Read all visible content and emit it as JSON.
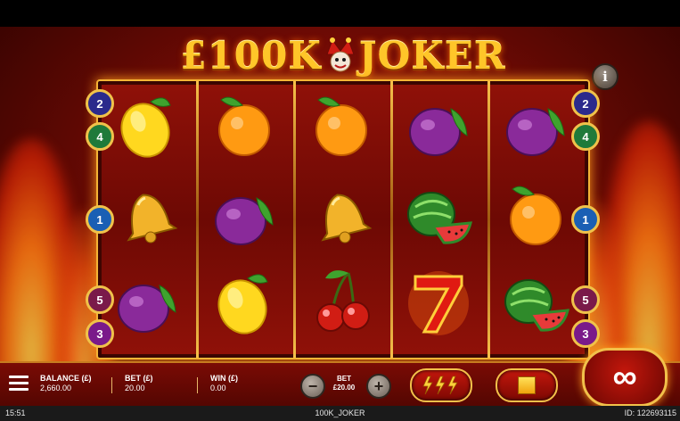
{
  "game": {
    "title": "£100K JOKER",
    "title_left": "£100K",
    "title_right": "JOKER"
  },
  "info_button": {
    "label": "i"
  },
  "reels": [
    [
      "lemon",
      "bell",
      "plum"
    ],
    [
      "orange",
      "plum",
      "lemon"
    ],
    [
      "orange",
      "bell",
      "cherries"
    ],
    [
      "plum",
      "watermelon",
      "seven"
    ],
    [
      "plum",
      "orange",
      "watermelon"
    ]
  ],
  "paylines": {
    "left": [
      {
        "label": "2",
        "color": "#2b2a8c"
      },
      {
        "label": "4",
        "color": "#1f7a3a"
      },
      {
        "label": "1",
        "color": "#1a5fb4"
      },
      {
        "label": "5",
        "color": "#7a1a4a"
      },
      {
        "label": "3",
        "color": "#7a1a8a"
      }
    ],
    "right": [
      {
        "label": "2",
        "color": "#2b2a8c"
      },
      {
        "label": "4",
        "color": "#1f7a3a"
      },
      {
        "label": "1",
        "color": "#1a5fb4"
      },
      {
        "label": "5",
        "color": "#7a1a4a"
      },
      {
        "label": "3",
        "color": "#7a1a8a"
      }
    ]
  },
  "bottom_bar": {
    "balance_label": "BALANCE (£)",
    "balance_value": "2,660.00",
    "bet_label": "BET (£)",
    "bet_value": "20.00",
    "win_label": "WIN (£)",
    "win_value": "0.00",
    "bet_selector_label": "BET",
    "bet_selector_value": "£20.00",
    "minus": "−",
    "plus": "+",
    "autoplay_symbol": "∞"
  },
  "status_bar": {
    "time": "15:51",
    "game_name": "100K_JOKER",
    "game_id": "ID: 122693115"
  },
  "colors": {
    "accent_gold": "#f2c14a",
    "background_red": "#8f1108"
  }
}
